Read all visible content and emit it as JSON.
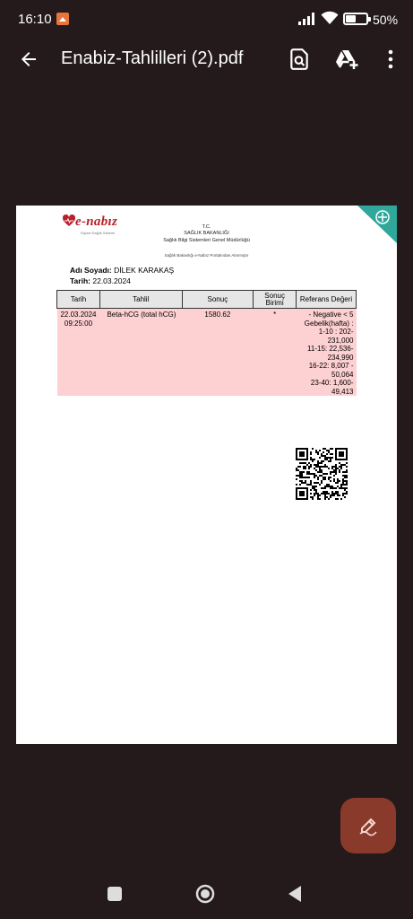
{
  "status_bar": {
    "time": "16:10",
    "battery_percent": "50%",
    "battery_level": 0.5,
    "icons": [
      "app-notification-icon",
      "signal-icon",
      "wifi-icon",
      "battery-icon"
    ]
  },
  "app_bar": {
    "title": "Enabiz-Tahlilleri (2).pdf",
    "icons": [
      "back-arrow-icon",
      "search-document-icon",
      "drive-add-icon",
      "more-vert-icon"
    ]
  },
  "document": {
    "logo_text": "e-nabız",
    "logo_tagline": "Kişisel Sağlık Sistemi",
    "header": {
      "line1": "T.C.",
      "line2": "SAĞLIK BAKANLIĞI",
      "line3": "Sağlık Bilgi Sistemleri Genel Müdürlüğü",
      "source_note": "Sağlık Bakanlığı e-Nabız Portalından Alınmıştır"
    },
    "patient": {
      "name_label": "Adı Soyadı:",
      "name_value": "DİLEK KARAKAŞ",
      "date_label": "Tarih:",
      "date_value": "22.03.2024"
    },
    "table": {
      "headers": [
        "Tarih",
        "Tahlil",
        "Sonuç",
        "Sonuç Birimi",
        "Referans Değeri"
      ],
      "row": {
        "date": "22.03.2024",
        "time": "09:25:00",
        "test": "Beta-hCG (total hCG)",
        "result": "1580.62",
        "unit": "*",
        "reference": [
          "- Negative < 5",
          "Gebelik(hafta) :",
          "1-10 :   202-",
          "231,000",
          "11-15:  22,536-",
          "234,990",
          "16-22:  8,007 -",
          "50,064",
          "23-40:  1,600-",
          "49,413"
        ]
      }
    },
    "qr_code": "qr-code"
  },
  "fab": {
    "icon": "edit-pen-icon"
  },
  "nav_bar": {
    "icons": [
      "recents-square-icon",
      "home-circle-icon",
      "back-triangle-icon"
    ]
  },
  "colors": {
    "background": "#241a1b",
    "fab": "#8a3a2a",
    "row_highlight": "#fdd0d2",
    "brand_red": "#b8202b",
    "corner_teal": "#2fa79a"
  }
}
